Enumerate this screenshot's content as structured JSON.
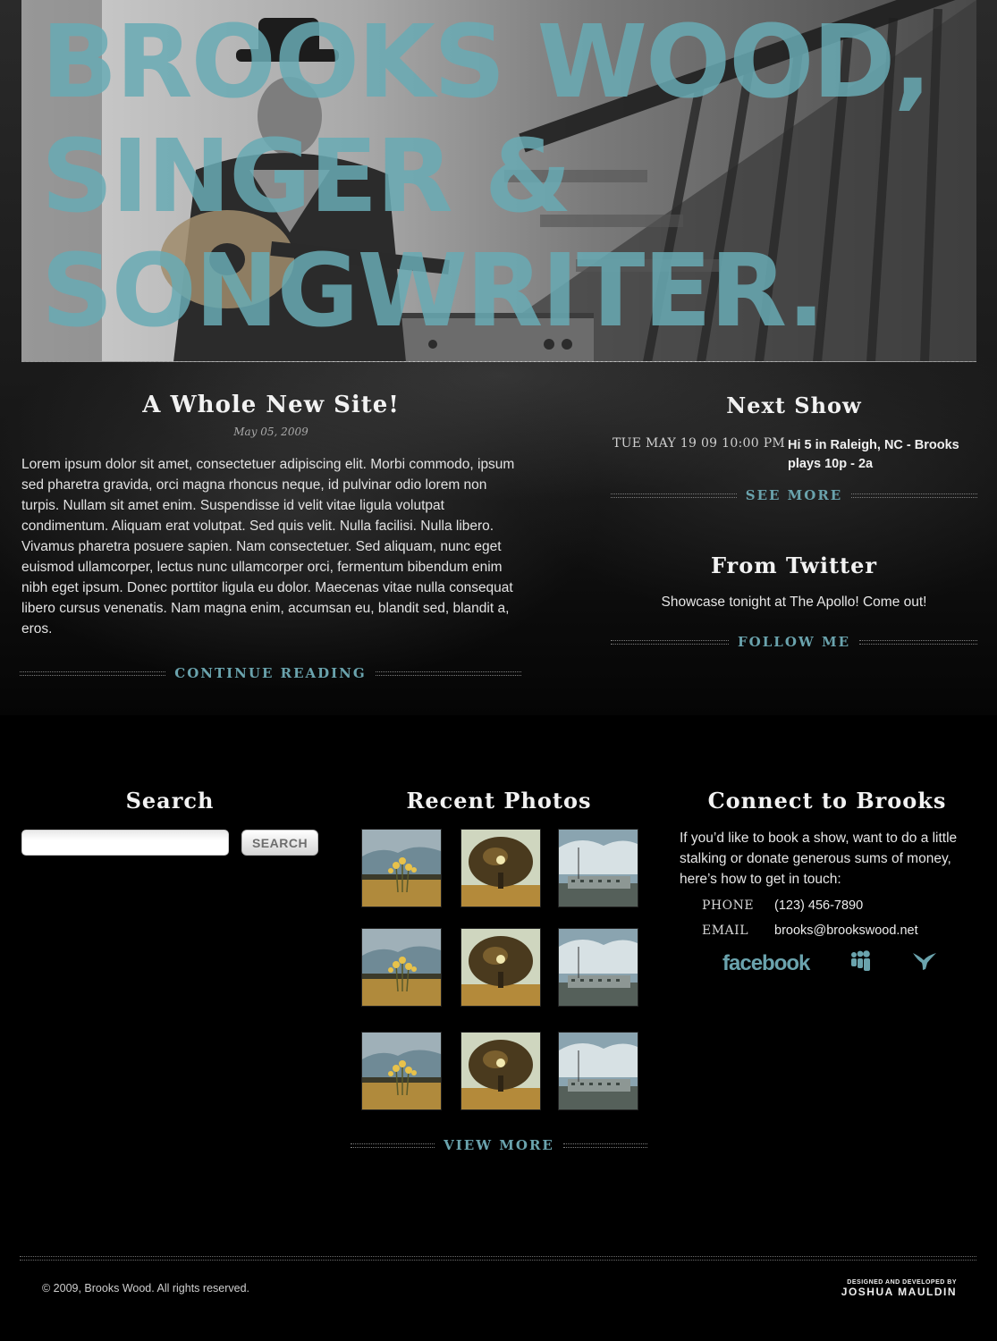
{
  "hero": {
    "title_lines": [
      "Brooks Wood,",
      "Singer &",
      "Songwriter."
    ]
  },
  "post": {
    "title": "A Whole New Site!",
    "date": "May 05, 2009",
    "body": "Lorem ipsum dolor sit amet, consectetuer adipiscing elit. Morbi commodo, ipsum sed pharetra gravida, orci magna rhoncus neque, id pulvinar odio lorem non turpis. Nullam sit amet enim. Suspendisse id velit vitae ligula volutpat condimentum. Aliquam erat volutpat. Sed quis velit. Nulla facilisi. Nulla libero. Vivamus pharetra posuere sapien. Nam consectetuer. Sed aliquam, nunc eget euismod ullamcorper, lectus nunc ullamcorper orci, fermentum bibendum enim nibh eget ipsum. Donec porttitor ligula eu dolor. Maecenas vitae nulla consequat libero cursus venenatis. Nam magna enim, accumsan eu, blandit sed, blandit a, eros.",
    "continue_label": "Continue Reading"
  },
  "next_show": {
    "heading": "Next Show",
    "date": "TUE MAY 19 09 10:00 PM",
    "description": "Hi 5 in Raleigh, NC - Brooks plays 10p - 2a",
    "see_more_label": "See More"
  },
  "twitter": {
    "heading": "From Twitter",
    "tweet": "Showcase tonight at The Apollo! Come out!",
    "follow_label": "Follow Me"
  },
  "search": {
    "heading": "Search",
    "input_value": "",
    "button_label": "SEARCH"
  },
  "photos": {
    "heading": "Recent Photos",
    "thumbnails": [
      "flowers-field",
      "oak-tree",
      "factory-sky",
      "flowers-field",
      "oak-tree",
      "factory-sky",
      "flowers-field",
      "oak-tree",
      "factory-sky"
    ],
    "view_more_label": "View More"
  },
  "connect": {
    "heading": "Connect to Brooks",
    "intro": "If you’d like to book a show, want to do a little stalking or donate generous sums of money, here’s how to get in touch:",
    "phone_label": "PHONE",
    "phone": "(123) 456-7890",
    "email_label": "EMAIL",
    "email": "brooks@brookswood.net",
    "facebook_label": "facebook",
    "icons": [
      "facebook-icon",
      "myspace-icon",
      "twitter-bird-icon"
    ]
  },
  "footer": {
    "copyright": "© 2009, Brooks Wood. All rights reserved.",
    "credit_small": "DESIGNED AND DEVELOPED BY",
    "credit_name": "JOSHUA MAULDIN"
  },
  "colors": {
    "accent": "#6aa3ad",
    "background": "#000000",
    "hero_text": "#69aab4"
  }
}
